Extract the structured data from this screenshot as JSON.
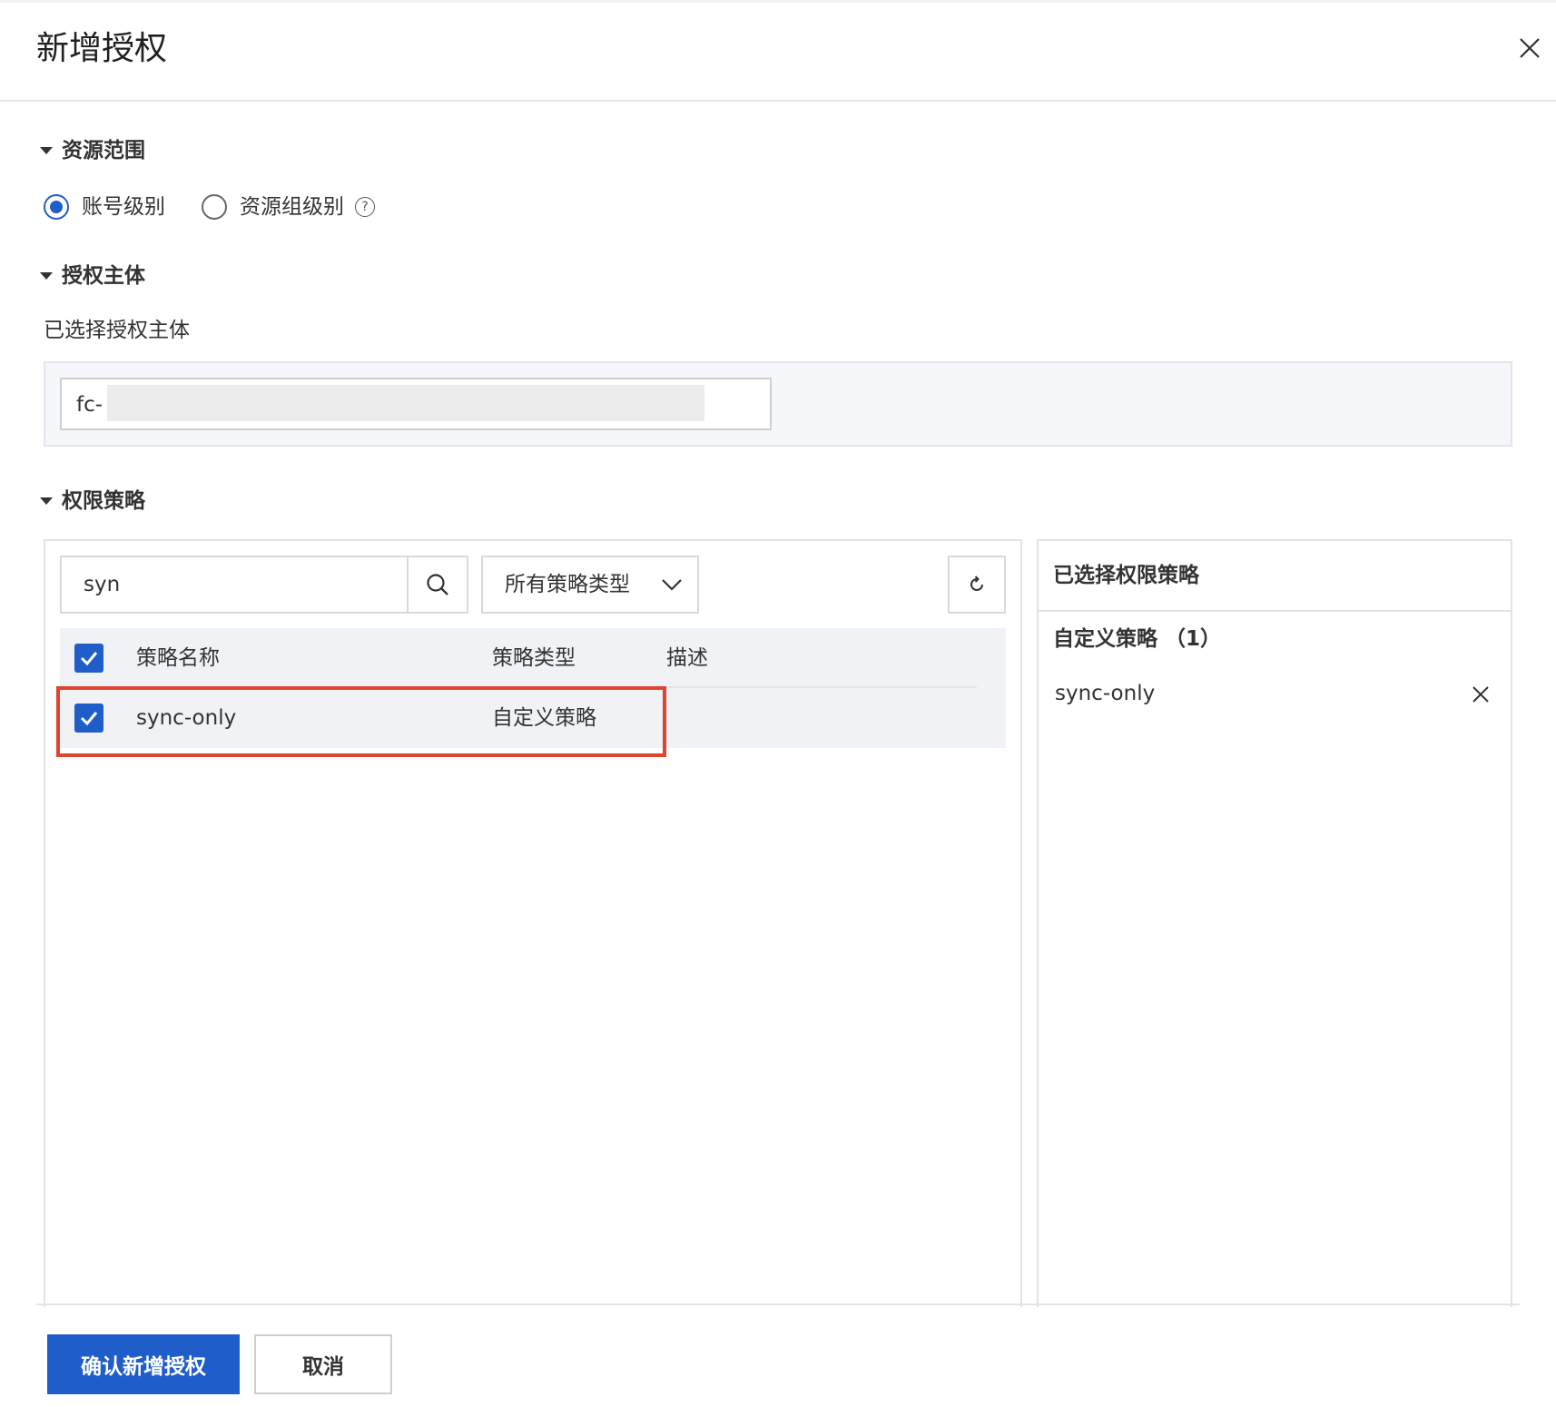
{
  "dialog": {
    "title": "新增授权",
    "close_icon": "close-icon"
  },
  "resource_scope": {
    "heading": "资源范围",
    "options": [
      {
        "label": "账号级别",
        "checked": true
      },
      {
        "label": "资源组级别",
        "checked": false
      }
    ],
    "help_icon": "question-circle-icon"
  },
  "principal": {
    "heading": "授权主体",
    "selected_label": "已选择授权主体",
    "value_prefix": "fc-"
  },
  "policy": {
    "heading": "权限策略",
    "search_value": "syn",
    "search_icon": "search-icon",
    "type_filter": "所有策略类型",
    "refresh_icon": "refresh-icon",
    "columns": [
      "策略名称",
      "策略类型",
      "描述"
    ],
    "rows": [
      {
        "name": "sync-only",
        "type": "自定义策略",
        "description": "",
        "checked": true
      }
    ],
    "header_checked": true
  },
  "selected_panel": {
    "title": "已选择权限策略",
    "group_label": "自定义策略 （1）",
    "items": [
      "sync-only"
    ]
  },
  "footer": {
    "confirm_label": "确认新增授权",
    "cancel_label": "取消"
  },
  "colors": {
    "primary": "#1f5ec9",
    "highlight": "#e0432e"
  }
}
